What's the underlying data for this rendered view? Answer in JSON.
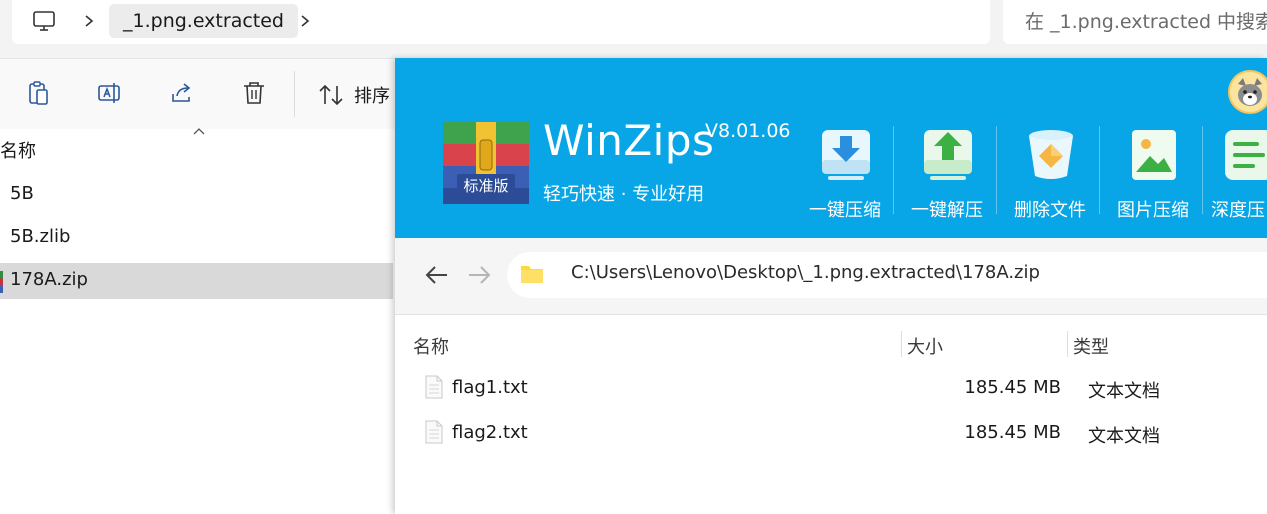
{
  "explorer": {
    "breadcrumb": "_1.png.extracted",
    "search_placeholder": "在 _1.png.extracted 中搜索",
    "toolbar": {
      "sort_label": "排序"
    },
    "column_name": "名称",
    "files": [
      {
        "name": "5B",
        "selected": false
      },
      {
        "name": "5B.zlib",
        "selected": false
      },
      {
        "name": "178A.zip",
        "selected": true
      }
    ]
  },
  "winzips": {
    "title": "WinZips",
    "version": "V8.01.06",
    "slogan": "轻巧快速 · 专业好用",
    "logo_badge": "标准版",
    "tools": [
      {
        "label": "一键压缩",
        "icon": "compress-icon"
      },
      {
        "label": "一键解压",
        "icon": "extract-icon"
      },
      {
        "label": "删除文件",
        "icon": "delete-file-icon"
      },
      {
        "label": "图片压缩",
        "icon": "image-compress-icon"
      },
      {
        "label": "深度压",
        "icon": "deep-compress-icon"
      }
    ],
    "path": "C:\\Users\\Lenovo\\Desktop\\_1.png.extracted\\178A.zip",
    "columns": {
      "name": "名称",
      "size": "大小",
      "type": "类型"
    },
    "files": [
      {
        "name": "flag1.txt",
        "size": "185.45 MB",
        "type": "文本文档"
      },
      {
        "name": "flag2.txt",
        "size": "185.45 MB",
        "type": "文本文档"
      }
    ]
  },
  "colors": {
    "header_blue": "#08a6e6",
    "selection_gray": "#d9d9d9",
    "folder_yellow": "#ffd83d"
  }
}
